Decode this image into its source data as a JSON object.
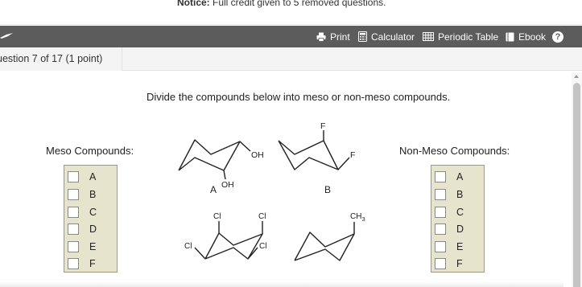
{
  "notice": {
    "label": "Notice:",
    "text": "Full credit given to 5 removed questions."
  },
  "toolbar": {
    "print": "Print",
    "calculator": "Calculator",
    "periodic_table": "Periodic Table",
    "ebook": "Ebook",
    "help": "?"
  },
  "question": {
    "label": "uestion 7 of 17 (1 point)"
  },
  "instructions": "Divide the compounds below into meso or non-meso compounds.",
  "meso": {
    "heading": "Meso Compounds:",
    "items": [
      "A",
      "B",
      "C",
      "D",
      "E",
      "F"
    ]
  },
  "nonmeso": {
    "heading": "Non-Meso Compounds:",
    "items": [
      "A",
      "B",
      "C",
      "D",
      "E",
      "F"
    ]
  },
  "molecules": {
    "A": {
      "letter": "A",
      "groups": [
        "OH",
        "OH"
      ]
    },
    "B": {
      "letter": "B",
      "groups": [
        "F",
        "F"
      ]
    },
    "C": {
      "groups": [
        "Cl",
        "Cl",
        "Cl",
        "Cl"
      ]
    },
    "D": {
      "groups": [
        "CH",
        "3"
      ]
    }
  },
  "colors": {
    "toolbar": "#5c5c5c",
    "bin": "#e6e4cc",
    "bin_border": "#9d9b7e",
    "header": "#f4f4f4"
  }
}
